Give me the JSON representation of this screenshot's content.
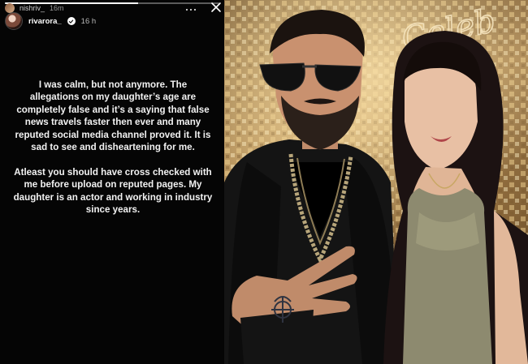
{
  "previous_story": {
    "username": "nishriv_",
    "time": "16m"
  },
  "story": {
    "username": "rivarora_",
    "time": "16 h",
    "paragraphs": [
      "I was calm, but not anymore. The allegations on my daughter’s age are completely false and it’s a saying that false news travels faster then ever and many reputed social media channel proved it. It is sad to see and disheartening for me.",
      "Atleast you should have cross checked with me before upload on reputed pages. My daughter is an actor and working in industry since years."
    ],
    "progress": 0.62
  },
  "photo": {
    "background_script": "Celeb"
  },
  "colors": {
    "story_bg": "#050505",
    "text": "#f2f2f2",
    "gold": "#b8914f"
  }
}
